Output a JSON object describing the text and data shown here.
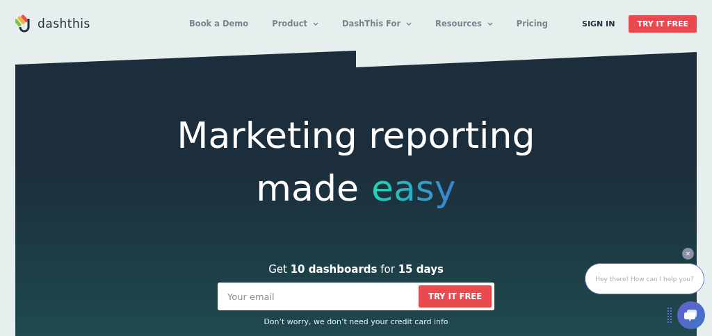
{
  "header": {
    "brand": "dashthis",
    "nav": [
      {
        "label": "Book a Demo",
        "has_dropdown": false
      },
      {
        "label": "Product",
        "has_dropdown": true
      },
      {
        "label": "DashThis For",
        "has_dropdown": true
      },
      {
        "label": "Resources",
        "has_dropdown": true
      },
      {
        "label": "Pricing",
        "has_dropdown": false
      }
    ],
    "sign_in": "SIGN IN",
    "cta": "TRY IT FREE"
  },
  "hero": {
    "headline": [
      {
        "text": "Marketing reporting"
      },
      {
        "text": "made",
        "highlight": "easy"
      }
    ],
    "offer": "Get **10 dashboards** for **15 days**",
    "email": {
      "placeholder": "Your email"
    },
    "submit": "TRY IT FREE",
    "note": "Don’t worry, we don’t need your credit card info"
  },
  "chat": {
    "close": "×",
    "message": "Hey there! How can I help you?"
  }
}
